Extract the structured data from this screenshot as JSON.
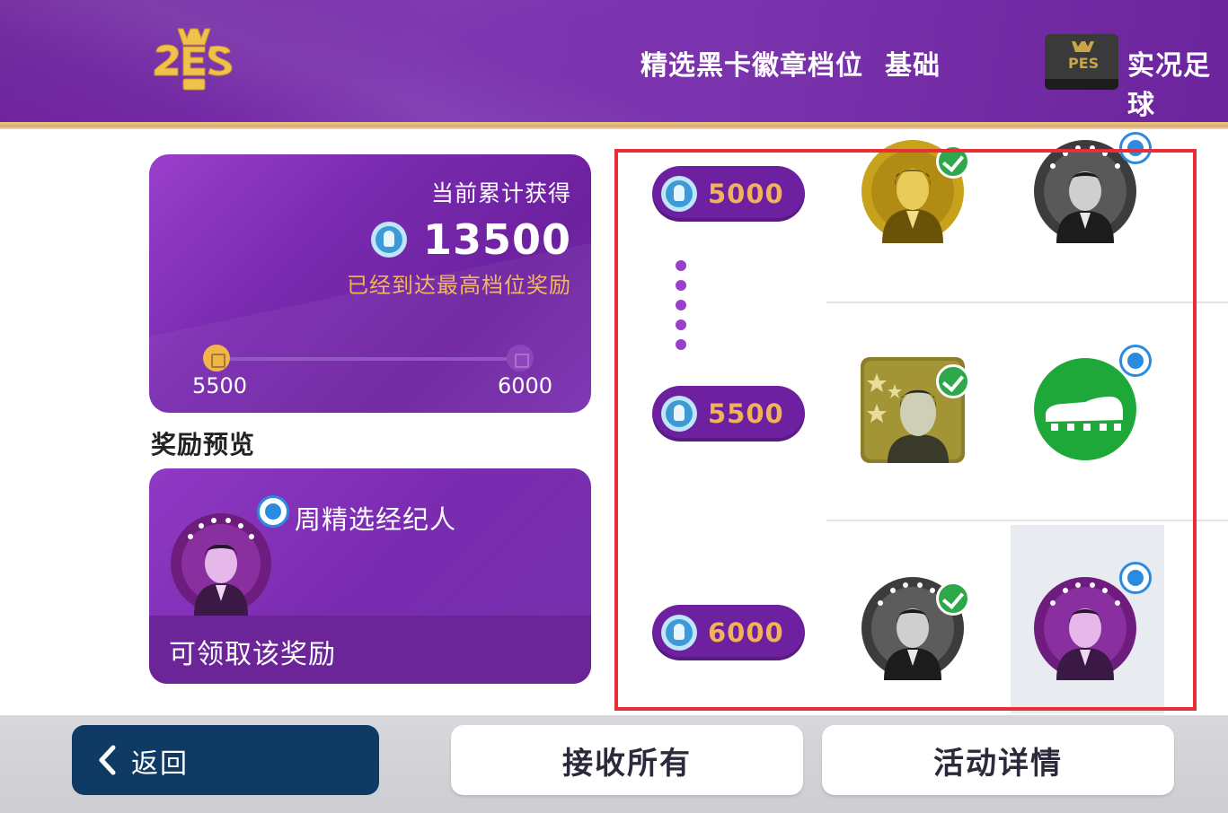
{
  "header": {
    "nav_items": [
      {
        "label": "精选黑卡徽章档位"
      },
      {
        "label": "基础"
      },
      {
        "label": "实况足球"
      }
    ]
  },
  "summary": {
    "title": "当前累计获得",
    "total": "13500",
    "status": "已经到达最高档位奖励",
    "progress": {
      "start_label": "5500",
      "end_label": "6000"
    }
  },
  "preview": {
    "section_title": "奖励预览",
    "reward_name": "周精选经纪人",
    "status": "可领取该奖励"
  },
  "tiers": [
    {
      "amount": "5000"
    },
    {
      "amount": "5500"
    },
    {
      "amount": "6000"
    }
  ],
  "footer": {
    "back_label": "返回",
    "claim_all_label": "接收所有",
    "details_label": "活动详情"
  },
  "colors": {
    "brand_purple": "#7a2bb0",
    "gold_text": "#f2b25a",
    "highlight_red": "#e82e36",
    "back_button": "#0f3a63",
    "claimed_green": "#2ea84a",
    "tap_blue": "#2a8be0"
  }
}
